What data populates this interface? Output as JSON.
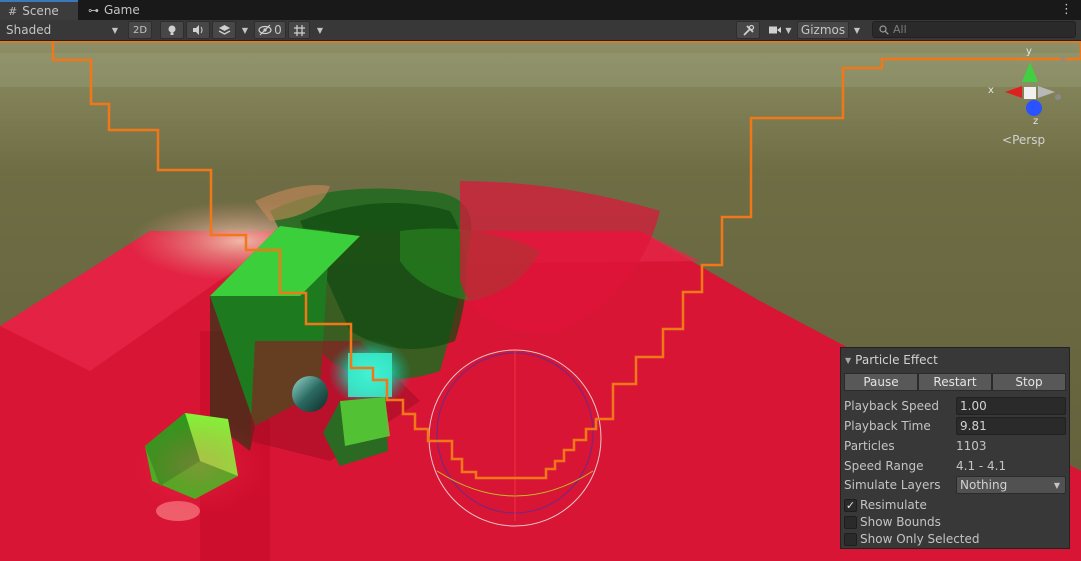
{
  "tabs": [
    {
      "label": "Scene",
      "icon": "grid-icon"
    },
    {
      "label": "Game",
      "icon": "gamepad-icon"
    }
  ],
  "toolbar": {
    "shading_mode": "Shaded",
    "mode_2d": "2D",
    "hidden_count": "0",
    "gizmos_label": "Gizmos",
    "search_placeholder": "All"
  },
  "gizmo": {
    "x_label": "x",
    "y_label": "y",
    "z_label": "z",
    "projection": "Persp"
  },
  "particle_panel": {
    "title": "Particle Effect",
    "buttons": {
      "pause": "Pause",
      "restart": "Restart",
      "stop": "Stop"
    },
    "rows": {
      "playback_speed": {
        "label": "Playback Speed",
        "value": "1.00"
      },
      "playback_time": {
        "label": "Playback Time",
        "value": "9.81"
      },
      "particles": {
        "label": "Particles",
        "value": "1103"
      },
      "speed_range": {
        "label": "Speed Range",
        "value": "4.1 - 4.1"
      },
      "simulate_layers": {
        "label": "Simulate Layers",
        "value": "Nothing"
      }
    },
    "checkboxes": {
      "resimulate": {
        "label": "Resimulate",
        "checked": true
      },
      "show_bounds": {
        "label": "Show Bounds",
        "checked": false
      },
      "show_only_selected": {
        "label": "Show Only Selected",
        "checked": false
      }
    }
  },
  "colors": {
    "accent_tab": "#3a79bb",
    "bounds_outline": "#f07818",
    "floor_red": "#e01030",
    "cube_green": "#28c828",
    "sky": "#6e6d42"
  }
}
